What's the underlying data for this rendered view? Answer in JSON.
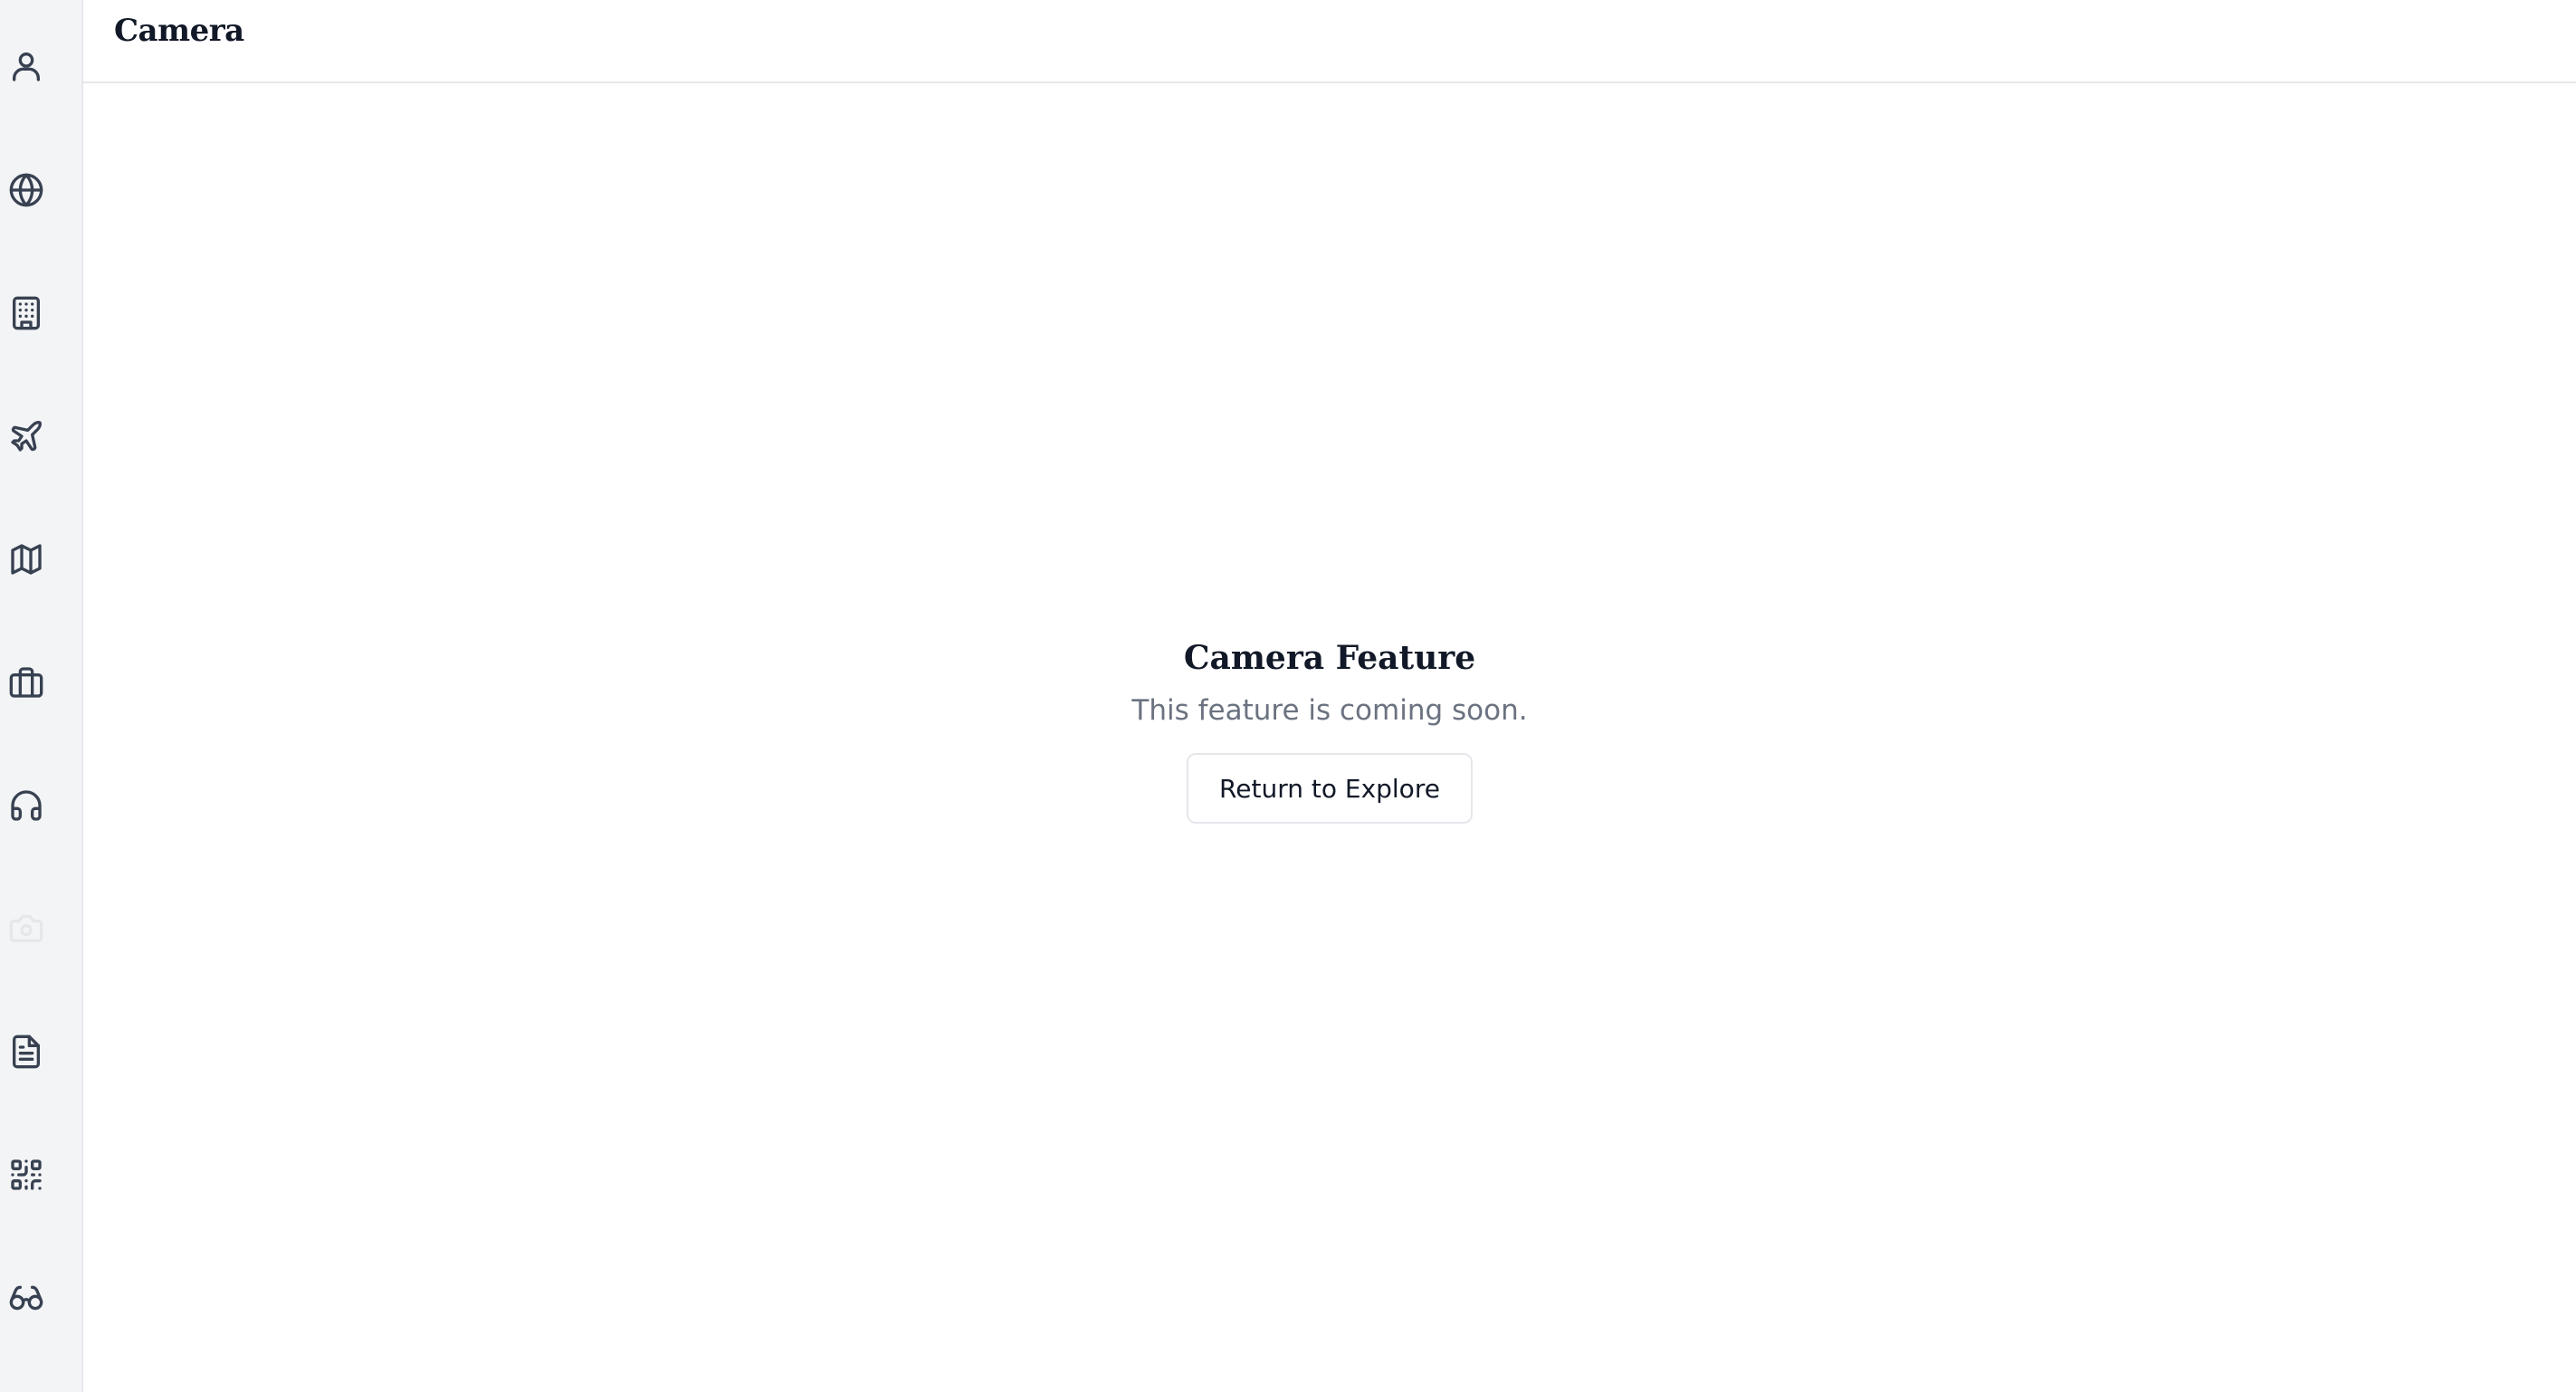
{
  "header": {
    "title": "Camera"
  },
  "sidebar": {
    "items": [
      {
        "icon": "user-icon",
        "active": false
      },
      {
        "icon": "globe-icon",
        "active": false
      },
      {
        "icon": "building-icon",
        "active": false
      },
      {
        "icon": "plane-icon",
        "active": false
      },
      {
        "icon": "map-icon",
        "active": false
      },
      {
        "icon": "briefcase-icon",
        "active": false
      },
      {
        "icon": "headphones-icon",
        "active": false
      },
      {
        "icon": "camera-icon",
        "active": true
      },
      {
        "icon": "document-icon",
        "active": false
      },
      {
        "icon": "qr-code-icon",
        "active": false
      },
      {
        "icon": "glasses-icon",
        "active": false
      }
    ]
  },
  "main": {
    "title": "Camera Feature",
    "subtitle": "This feature is coming soon.",
    "button_label": "Return to Explore"
  },
  "colors": {
    "sidebar_bg": "#f3f4f6",
    "icon": "#374151",
    "active_icon": "#e5e7eb",
    "text_primary": "#111827",
    "text_muted": "#6b7280",
    "border": "#e5e7eb"
  }
}
